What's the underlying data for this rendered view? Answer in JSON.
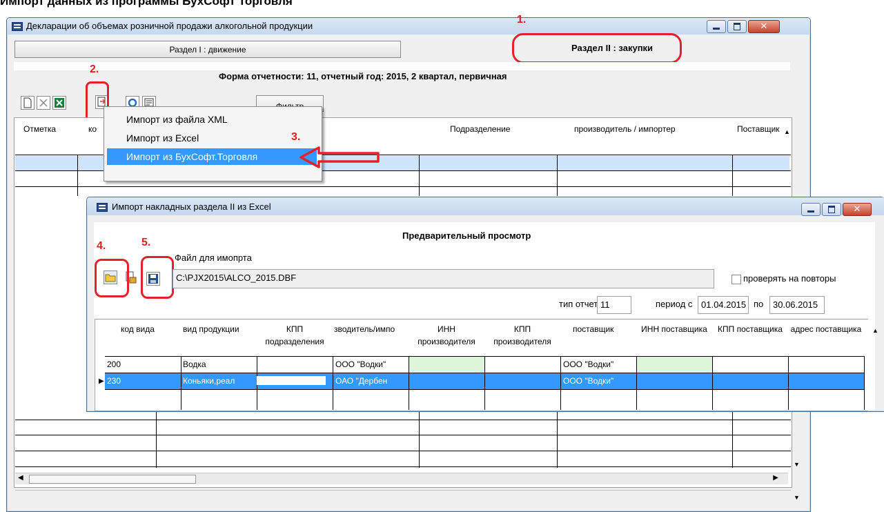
{
  "page_heading": "Импорт данных из программы БухСофт Торговля",
  "main_window": {
    "title": "Декларации об объемах розничной продажи алкогольной продукции",
    "tab_section1": "Раздел I : движение",
    "tab_section2": "Раздел II : закупки",
    "report_info": "Форма отчетности: 11, отчетный год: 2015, 2 квартал, первичная",
    "filter_button": "Фильтр",
    "columns": {
      "mark": "Отметка",
      "code": "ко",
      "subdivision": "Подразделение",
      "producer": "производитель / импортер",
      "supplier": "Поставщик"
    }
  },
  "import_menu": {
    "items": [
      "Импорт из файла XML",
      "Импорт из Excel",
      "Импорт из БухСофт.Торговля"
    ],
    "selected_index": 2
  },
  "import_window": {
    "title": "Импорт накладных раздела II из Excel",
    "preview_title": "Предварительный просмотр",
    "file_label": "Файл для имопрта",
    "file_path": "C:\\PJX2015\\ALCO_2015.DBF",
    "check_repeats_label": "проверять на повторы",
    "report_type_label": "тип отчета",
    "report_type_value": "11",
    "period_from_label": "период с",
    "period_from": "01.04.2015",
    "period_to_label": "по",
    "period_to": "30.06.2015",
    "columns": [
      "код вида",
      "вид продукции",
      "КПП подразделения",
      "зводитель/импо",
      "ИНН производителя",
      "КПП производителя",
      "поставщик",
      "ИНН поставщика",
      "КПП поставщика",
      "адрес поставщика"
    ],
    "rows": [
      {
        "code": "200",
        "product": "Водка",
        "kpp_sub": "",
        "producer": "ООО \"Водки\"",
        "supplier": "ООО \"Водки\""
      },
      {
        "code": "230",
        "product": "Коньяки,реал",
        "kpp_sub": "",
        "producer": "ОАО \"Дербен",
        "supplier": "ООО \"Водки\""
      }
    ]
  },
  "annotations": [
    "1.",
    "2.",
    "3.",
    "4.",
    "5."
  ],
  "colors": {
    "accent_red": "#e6202a",
    "selection_blue": "#3399ff",
    "light_green_cell": "#ddf5d8",
    "selected_row_main": "#cde4fb"
  }
}
